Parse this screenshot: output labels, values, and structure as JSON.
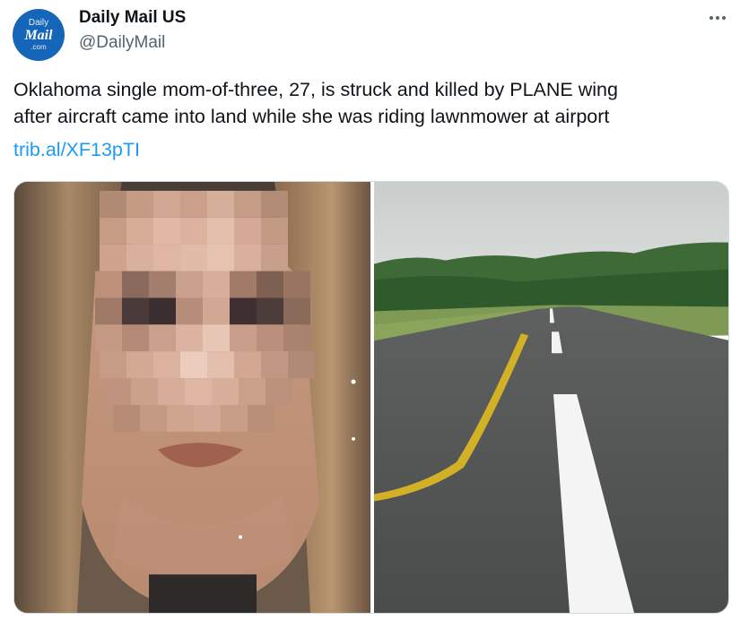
{
  "account": {
    "avatar_text": [
      "Daily",
      "Mail",
      ".com"
    ],
    "name": "Daily Mail US",
    "handle": "@DailyMail"
  },
  "tweet": {
    "text_lines": [
      "Oklahoma single mom-of-three, 27, is struck and killed by PLANE wing",
      "after aircraft came into land while she was riding lawnmower at airport"
    ],
    "link": "trib.al/XF13pTI"
  },
  "media": [
    {
      "name": "photo-woman-selfie-pixelated",
      "description_icon": "image-icon"
    },
    {
      "name": "photo-airport-runway",
      "description_icon": "image-icon"
    }
  ],
  "icons": {
    "more": "more-options-icon"
  },
  "colors": {
    "link": "#1d9bf0",
    "text": "#0f1419",
    "secondary": "#536471",
    "avatar_bg": "#1565b8"
  }
}
